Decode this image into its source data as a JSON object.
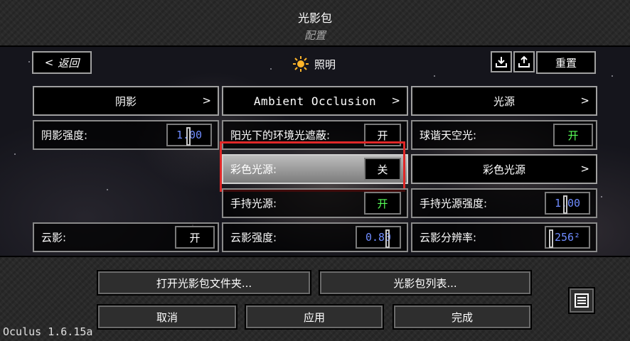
{
  "header": {
    "title": "光影包",
    "subtitle": "配置"
  },
  "nav": {
    "back_label": "返回",
    "back_glyph": "<",
    "section_icon": "sun-icon",
    "section_title": "照明",
    "download_icon": "download-icon",
    "upload_icon": "upload-icon",
    "reset_label": "重置"
  },
  "options": {
    "shadows": {
      "label": "阴影",
      "chevron": ">"
    },
    "ambient_occlusion": {
      "label": "Ambient Occlusion",
      "chevron": ">"
    },
    "light_sources": {
      "label": "光源",
      "chevron": ">"
    },
    "shadow_strength": {
      "label": "阴影强度:",
      "value": "1.00"
    },
    "ao_sunlight": {
      "label": "阳光下的环境光遮蔽:",
      "value": "开"
    },
    "sh_sky_light": {
      "label": "球谐天空光:",
      "value": "开"
    },
    "colored_lights": {
      "label": "彩色光源:",
      "value": "关"
    },
    "colored_lights_menu": {
      "label": "彩色光源",
      "chevron": ">"
    },
    "handheld_lights": {
      "label": "手持光源:",
      "value": "开"
    },
    "handheld_strength": {
      "label": "手持光源强度:",
      "value": "1.00"
    },
    "cloud_shadows": {
      "label": "云影:",
      "value": "开"
    },
    "cloud_shadow_strength": {
      "label": "云影强度:",
      "value": "0.80"
    },
    "cloud_shadow_res": {
      "label": "云影分辨率:",
      "value": "256²"
    }
  },
  "footer": {
    "open_folder": "打开光影包文件夹...",
    "pack_list": "光影包列表...",
    "cancel": "取消",
    "apply": "应用",
    "done": "完成",
    "side_icon": "screen-icon",
    "version": "Oculus 1.6.15a"
  },
  "colors": {
    "on": "#58ff58",
    "value_blue": "#6f8cff",
    "highlight": "#e02828"
  }
}
